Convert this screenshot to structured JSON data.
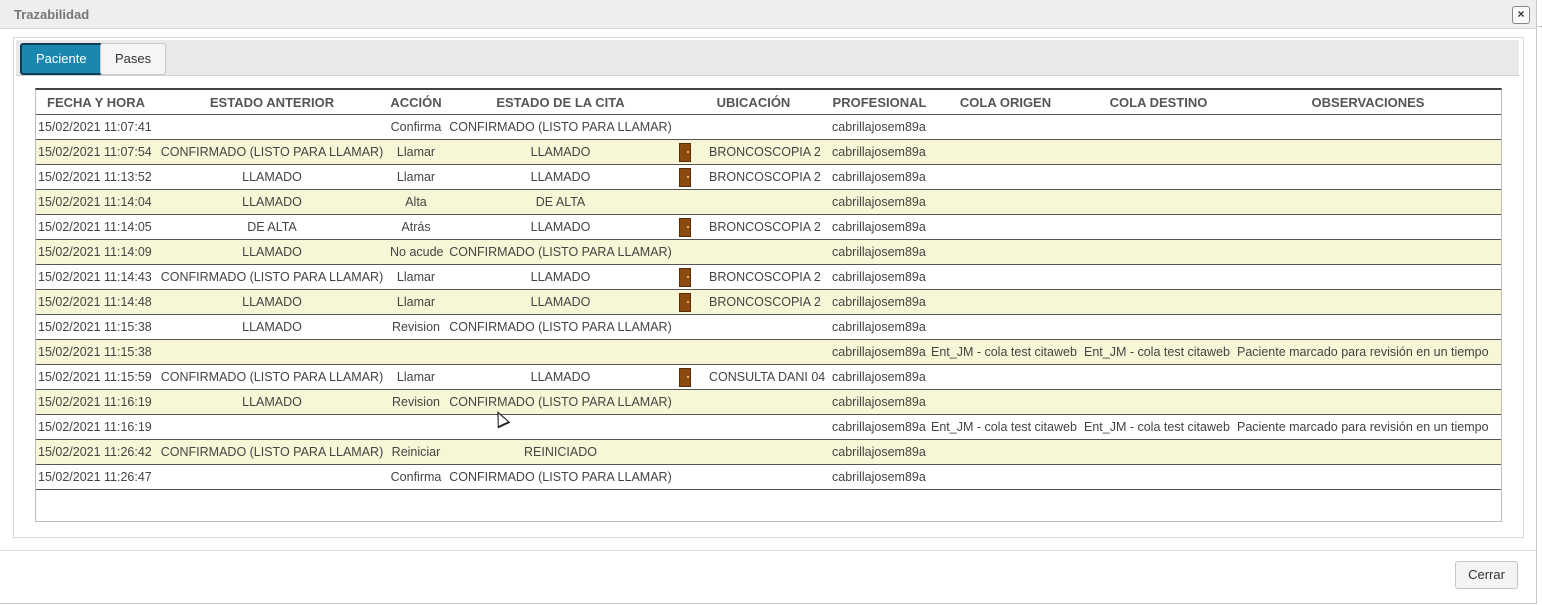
{
  "dialog": {
    "title": "Trazabilidad",
    "close_icon": "×",
    "close_button_label": "Cerrar"
  },
  "tabs": [
    {
      "label": "Paciente",
      "active": true
    },
    {
      "label": "Pases",
      "active": false
    }
  ],
  "columns": [
    "FECHA Y HORA",
    "ESTADO ANTERIOR",
    "ACCIÓN",
    "ESTADO DE LA CITA",
    "UBICACIÓN",
    "PROFESIONAL",
    "COLA ORIGEN",
    "COLA DESTINO",
    "OBSERVACIONES"
  ],
  "rows": [
    {
      "fecha": "15/02/2021 11:07:41",
      "estado_anterior": "",
      "accion": "Confirma",
      "estado_cita": "CONFIRMADO (LISTO PARA LLAMAR)",
      "ubicacion": "",
      "door": false,
      "profesional": "cabrillajosem89a",
      "cola_origen": "",
      "cola_destino": "",
      "observaciones": ""
    },
    {
      "fecha": "15/02/2021 11:07:54",
      "estado_anterior": "CONFIRMADO (LISTO PARA LLAMAR)",
      "accion": "Llamar",
      "estado_cita": "LLAMADO",
      "ubicacion": "BRONCOSCOPIA 2",
      "door": true,
      "profesional": "cabrillajosem89a",
      "cola_origen": "",
      "cola_destino": "",
      "observaciones": ""
    },
    {
      "fecha": "15/02/2021 11:13:52",
      "estado_anterior": "LLAMADO",
      "accion": "Llamar",
      "estado_cita": "LLAMADO",
      "ubicacion": "BRONCOSCOPIA 2",
      "door": true,
      "profesional": "cabrillajosem89a",
      "cola_origen": "",
      "cola_destino": "",
      "observaciones": ""
    },
    {
      "fecha": "15/02/2021 11:14:04",
      "estado_anterior": "LLAMADO",
      "accion": "Alta",
      "estado_cita": "DE ALTA",
      "ubicacion": "",
      "door": false,
      "profesional": "cabrillajosem89a",
      "cola_origen": "",
      "cola_destino": "",
      "observaciones": ""
    },
    {
      "fecha": "15/02/2021 11:14:05",
      "estado_anterior": "DE ALTA",
      "accion": "Atrás",
      "estado_cita": "LLAMADO",
      "ubicacion": "BRONCOSCOPIA 2",
      "door": true,
      "profesional": "cabrillajosem89a",
      "cola_origen": "",
      "cola_destino": "",
      "observaciones": ""
    },
    {
      "fecha": "15/02/2021 11:14:09",
      "estado_anterior": "LLAMADO",
      "accion": "No acude",
      "estado_cita": "CONFIRMADO (LISTO PARA LLAMAR)",
      "ubicacion": "",
      "door": false,
      "profesional": "cabrillajosem89a",
      "cola_origen": "",
      "cola_destino": "",
      "observaciones": ""
    },
    {
      "fecha": "15/02/2021 11:14:43",
      "estado_anterior": "CONFIRMADO (LISTO PARA LLAMAR)",
      "accion": "Llamar",
      "estado_cita": "LLAMADO",
      "ubicacion": "BRONCOSCOPIA 2",
      "door": true,
      "profesional": "cabrillajosem89a",
      "cola_origen": "",
      "cola_destino": "",
      "observaciones": ""
    },
    {
      "fecha": "15/02/2021 11:14:48",
      "estado_anterior": "LLAMADO",
      "accion": "Llamar",
      "estado_cita": "LLAMADO",
      "ubicacion": "BRONCOSCOPIA 2",
      "door": true,
      "profesional": "cabrillajosem89a",
      "cola_origen": "",
      "cola_destino": "",
      "observaciones": ""
    },
    {
      "fecha": "15/02/2021 11:15:38",
      "estado_anterior": "LLAMADO",
      "accion": "Revision",
      "estado_cita": "CONFIRMADO (LISTO PARA LLAMAR)",
      "ubicacion": "",
      "door": false,
      "profesional": "cabrillajosem89a",
      "cola_origen": "",
      "cola_destino": "",
      "observaciones": ""
    },
    {
      "fecha": "15/02/2021 11:15:38",
      "estado_anterior": "",
      "accion": "",
      "estado_cita": "",
      "ubicacion": "",
      "door": false,
      "profesional": "cabrillajosem89a",
      "cola_origen": "Ent_JM - cola test citaweb",
      "cola_destino": "Ent_JM - cola test citaweb",
      "observaciones": "Paciente marcado para revisión en un tiempo"
    },
    {
      "fecha": "15/02/2021 11:15:59",
      "estado_anterior": "CONFIRMADO (LISTO PARA LLAMAR)",
      "accion": "Llamar",
      "estado_cita": "LLAMADO",
      "ubicacion": "CONSULTA DANI 04",
      "door": true,
      "profesional": "cabrillajosem89a",
      "cola_origen": "",
      "cola_destino": "",
      "observaciones": ""
    },
    {
      "fecha": "15/02/2021 11:16:19",
      "estado_anterior": "LLAMADO",
      "accion": "Revision",
      "estado_cita": "CONFIRMADO (LISTO PARA LLAMAR)",
      "ubicacion": "",
      "door": false,
      "profesional": "cabrillajosem89a",
      "cola_origen": "",
      "cola_destino": "",
      "observaciones": ""
    },
    {
      "fecha": "15/02/2021 11:16:19",
      "estado_anterior": "",
      "accion": "",
      "estado_cita": "",
      "ubicacion": "",
      "door": false,
      "profesional": "cabrillajosem89a",
      "cola_origen": "Ent_JM - cola test citaweb",
      "cola_destino": "Ent_JM - cola test citaweb",
      "observaciones": "Paciente marcado para revisión en un tiempo"
    },
    {
      "fecha": "15/02/2021 11:26:42",
      "estado_anterior": "CONFIRMADO (LISTO PARA LLAMAR)",
      "accion": "Reiniciar",
      "estado_cita": "REINICIADO",
      "ubicacion": "",
      "door": false,
      "profesional": "cabrillajosem89a",
      "cola_origen": "",
      "cola_destino": "",
      "observaciones": ""
    },
    {
      "fecha": "15/02/2021 11:26:47",
      "estado_anterior": "",
      "accion": "Confirma",
      "estado_cita": "CONFIRMADO (LISTO PARA LLAMAR)",
      "ubicacion": "",
      "door": false,
      "profesional": "cabrillajosem89a",
      "cola_origen": "",
      "cola_destino": "",
      "observaciones": ""
    }
  ],
  "colors": {
    "active_tab": "#1a87b0",
    "alt_row": "#f7f6d6",
    "door_icon": "#8b4a12"
  },
  "icons": {
    "location": "door-icon",
    "close": "close-icon"
  }
}
